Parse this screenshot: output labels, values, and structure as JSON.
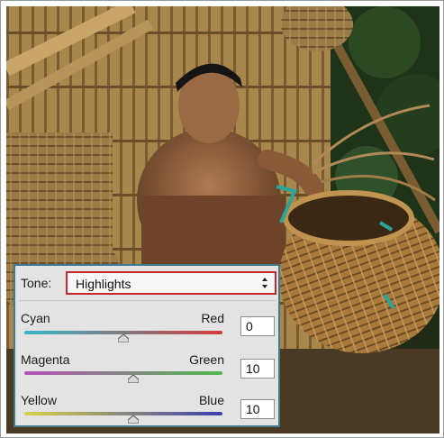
{
  "photo": {
    "description_icon": "photo-canvas"
  },
  "color_balance": {
    "tone_label": "Tone:",
    "tone_value": "Highlights",
    "rows": [
      {
        "left_label": "Cyan",
        "right_label": "Red",
        "value": "0",
        "position": 0.5,
        "track_colors": [
          "#36b8c9",
          "#d23a3a"
        ]
      },
      {
        "left_label": "Magenta",
        "right_label": "Green",
        "value": "10",
        "position": 0.55,
        "track_colors": [
          "#b650b6",
          "#4fb94f"
        ]
      },
      {
        "left_label": "Yellow",
        "right_label": "Blue",
        "value": "10",
        "position": 0.55,
        "track_colors": [
          "#d8d24a",
          "#3b3fb0"
        ]
      }
    ],
    "highlight_color": "#c4262e",
    "panel_border_color": "#3d7d8f"
  }
}
